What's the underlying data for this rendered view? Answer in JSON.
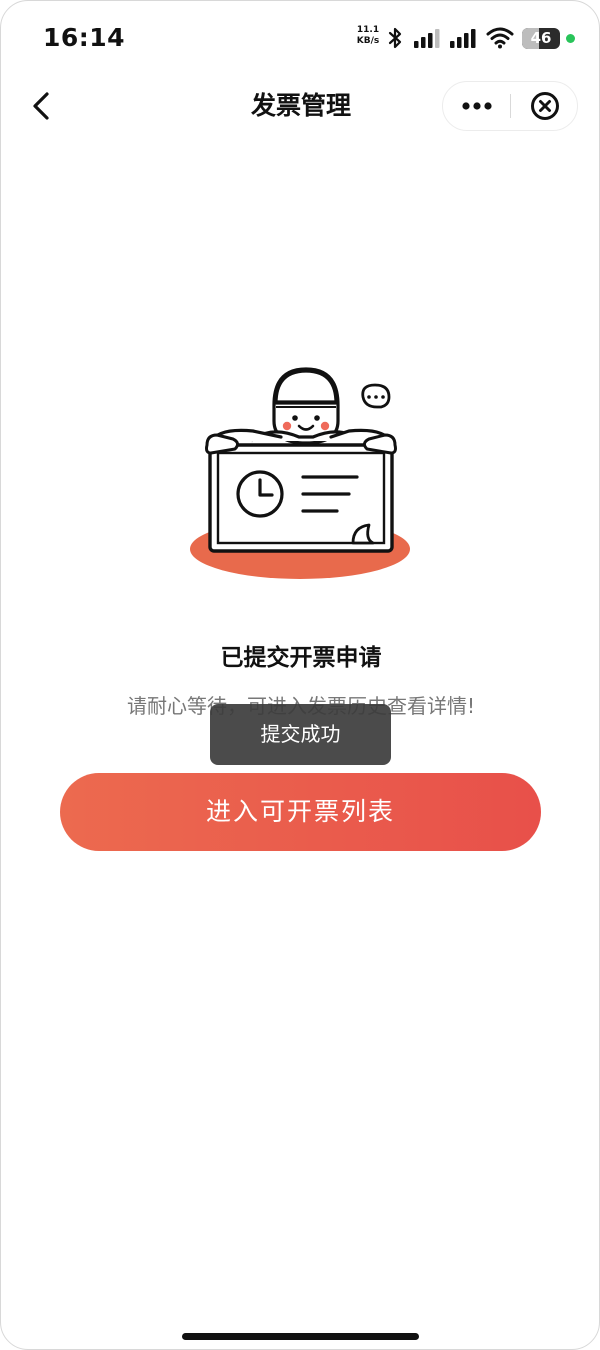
{
  "status_bar": {
    "time": "16:14",
    "net_speed_value": "11.1",
    "net_speed_unit": "KB/s",
    "battery_level": "46",
    "battery_fraction": 0.46,
    "charge_color": "#29c45a"
  },
  "nav": {
    "title": "发票管理"
  },
  "result": {
    "title": "已提交开票申请",
    "description": "请耐心等待，可进入发票历史查看详情!"
  },
  "toast": {
    "message": "提交成功"
  },
  "actions": {
    "primary_label": "进入可开票列表"
  },
  "colors": {
    "accent": "#e8504a",
    "accent_light": "#ec6a4f",
    "toast_bg": "#3c3c3c"
  },
  "icons": {
    "back": "chevron-left-icon",
    "more": "more-dots-icon",
    "close": "close-circle-icon",
    "illustration": "submitted-invoice-illustration"
  }
}
